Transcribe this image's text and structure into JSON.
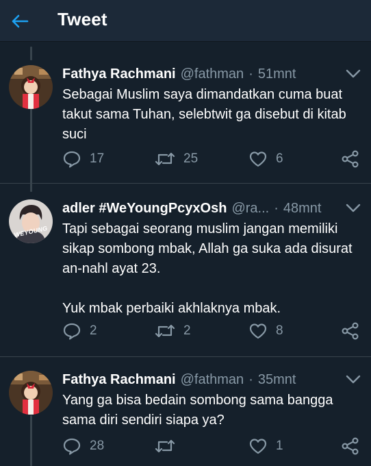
{
  "header": {
    "title": "Tweet"
  },
  "tweets": [
    {
      "name": "Fathya Rachmani",
      "handle": "@fathman",
      "separator": "·",
      "time": "51mnt",
      "text": "Sebagai Muslim saya dimandatkan cuma buat takut sama Tuhan, selebtwit ga disebut di kitab suci",
      "replies": "17",
      "retweets": "25",
      "likes": "6",
      "avatar_text": ""
    },
    {
      "name": "adler #WeYoungPcyxOsh",
      "handle": "@ra...",
      "separator": "·",
      "time": "48mnt",
      "text": "Tapi sebagai seorang muslim jangan memiliki sikap sombong mbak, Allah ga suka ada disurat an-nahl ayat 23.\n\nYuk mbak perbaiki akhlaknya mbak.",
      "replies": "2",
      "retweets": "2",
      "likes": "8",
      "avatar_text": "WEYOUNG"
    },
    {
      "name": "Fathya Rachmani",
      "handle": "@fathman",
      "separator": "·",
      "time": "35mnt",
      "text": "Yang ga bisa bedain sombong sama bangga sama diri sendiri siapa ya?",
      "replies": "28",
      "retweets": "",
      "likes": "1",
      "avatar_text": ""
    }
  ],
  "icons": {
    "back": "back-arrow-icon",
    "more": "chevron-down-icon",
    "reply": "reply-icon",
    "retweet": "retweet-icon",
    "like": "heart-icon",
    "share": "share-icon"
  },
  "colors": {
    "background": "#15202b",
    "header": "#1c2938",
    "accent": "#1da1f2",
    "muted": "#8899a6",
    "line": "#38444d"
  }
}
